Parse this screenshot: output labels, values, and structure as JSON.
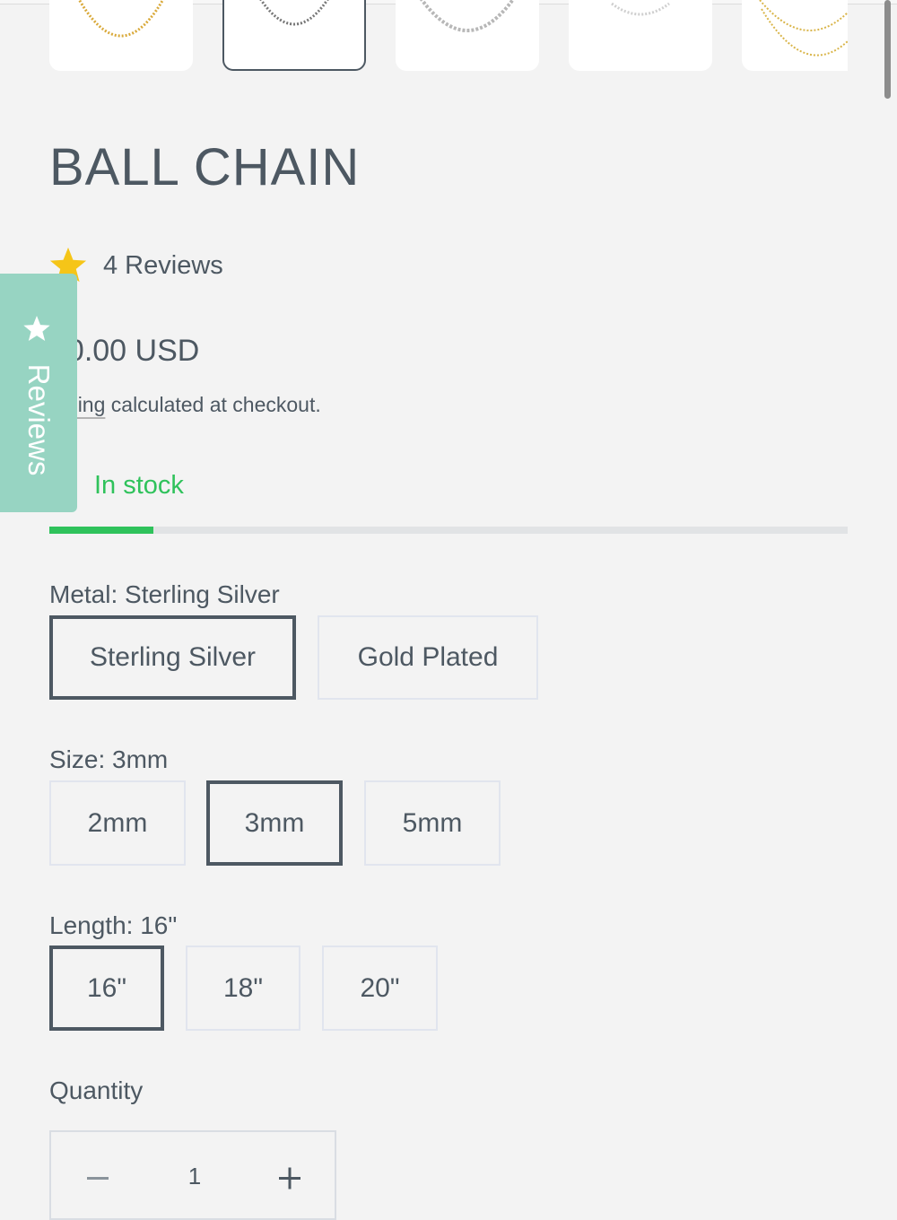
{
  "colors": {
    "text": "#4d5862",
    "accent_green": "#2fc25b",
    "reviews_tab": "#97d4c2",
    "star": "#f5c518",
    "background": "#f3f3f3"
  },
  "gallery": {
    "thumbnails": [
      {
        "icon": "gold-chain-image",
        "selected": false
      },
      {
        "icon": "silver-ball-chain-image",
        "selected": true
      },
      {
        "icon": "silver-bead-chain-image",
        "selected": false
      },
      {
        "icon": "fine-silver-chain-image",
        "selected": false
      },
      {
        "icon": "gold-layered-chain-image",
        "selected": false
      }
    ]
  },
  "product": {
    "title": "BALL CHAIN",
    "reviews_count_label": "4 Reviews",
    "price": "00.00 USD",
    "shipping_link": "ipping",
    "shipping_rest": " calculated at checkout.",
    "stock_status": "In stock",
    "stock_level_fraction": 0.13
  },
  "reviews_tab": {
    "label": "Reviews",
    "icon": "star-icon"
  },
  "options": {
    "metal": {
      "label": "Metal: Sterling Silver",
      "values": [
        "Sterling Silver",
        "Gold Plated"
      ],
      "selected": "Sterling Silver"
    },
    "size": {
      "label": "Size: 3mm",
      "values": [
        "2mm",
        "3mm",
        "5mm"
      ],
      "selected": "3mm"
    },
    "length": {
      "label": "Length: 16\"",
      "values": [
        "16\"",
        "18\"",
        "20\""
      ],
      "selected": "16\""
    }
  },
  "quantity": {
    "label": "Quantity",
    "value": "1",
    "decrease_icon": "minus-icon",
    "increase_icon": "plus-icon"
  }
}
